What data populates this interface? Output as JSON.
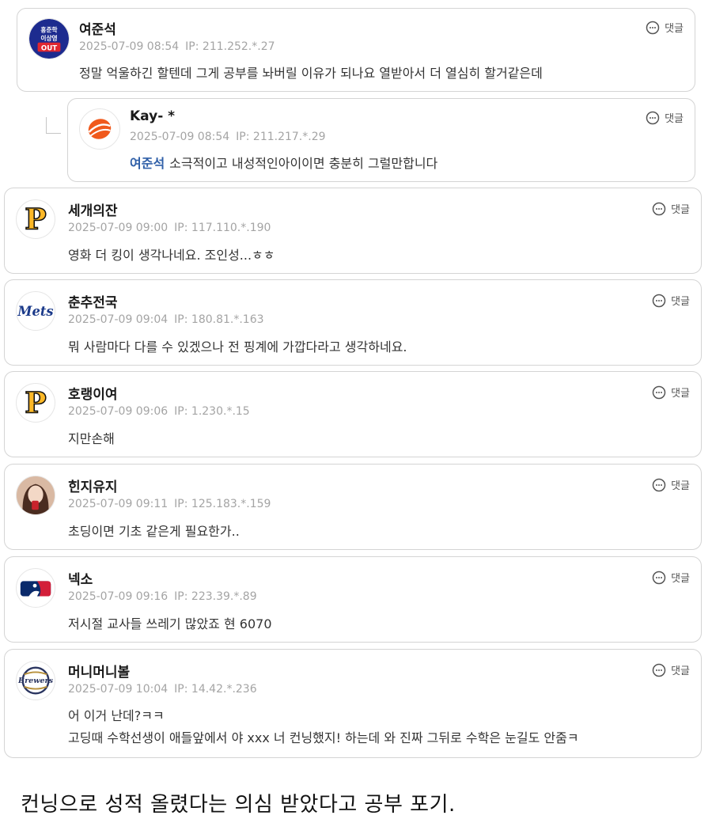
{
  "reply_label": "댓글",
  "comments": [
    {
      "nick": "여준석",
      "date": "2025-07-09 08:54",
      "ip": "IP: 211.252.*.27",
      "text": "정말 억울하긴 할텐데 그게 공부를 놔버릴 이유가 되나요 열받아서 더 열심히 할거같은데",
      "avatar": "badge-avatar",
      "badge_lines": [
        "홍준학",
        "이상영",
        "OUT"
      ]
    },
    {
      "nick": "Kay- *",
      "date": "2025-07-09 08:54",
      "ip": "IP: 211.217.*.29",
      "mention": "여준석",
      "text": "소극적이고 내성적인아이이면 충분히 그럴만합니다",
      "avatar": "orange-logo-avatar"
    },
    {
      "nick": "세개의잔",
      "date": "2025-07-09 09:00",
      "ip": "IP: 117.110.*.190",
      "text": "영화 더 킹이 생각나네요. 조인성...ㅎㅎ",
      "avatar": "pirates-logo-avatar",
      "logo_text": "P"
    },
    {
      "nick": "춘추전국",
      "date": "2025-07-09 09:04",
      "ip": "IP: 180.81.*.163",
      "text": "뭐 사람마다 다를 수 있겠으나 전 핑계에 가깝다라고 생각하네요.",
      "avatar": "mets-logo-avatar",
      "logo_text": "Mets"
    },
    {
      "nick": "호랭이여",
      "date": "2025-07-09 09:06",
      "ip": "IP: 1.230.*.15",
      "text": "지만손해",
      "avatar": "pirates-logo-avatar",
      "logo_text": "P"
    },
    {
      "nick": "힌지유지",
      "date": "2025-07-09 09:11",
      "ip": "IP: 125.183.*.159",
      "text": "초딩이면 기초 같은게 필요한가..",
      "avatar": "portrait-avatar"
    },
    {
      "nick": "넥소",
      "date": "2025-07-09 09:16",
      "ip": "IP: 223.39.*.89",
      "text": "저시절 교사들 쓰레기 많았죠 현 6070",
      "avatar": "mlb-logo-avatar"
    },
    {
      "nick": "머니머니볼",
      "date": "2025-07-09 10:04",
      "ip": "IP: 14.42.*.236",
      "text": "어 이거 난데?ㅋㅋ",
      "text2": "고딩때 수학선생이 애들앞에서 야 xxx 너 컨닝했지! 하는데 와 진짜 그뒤로 수학은 눈길도 안줌ㅋ",
      "avatar": "brewers-logo-avatar",
      "logo_text": "Brewers"
    }
  ],
  "caption": "컨닝으로 성적 올렸다는 의심 받았다고 공부 포기."
}
